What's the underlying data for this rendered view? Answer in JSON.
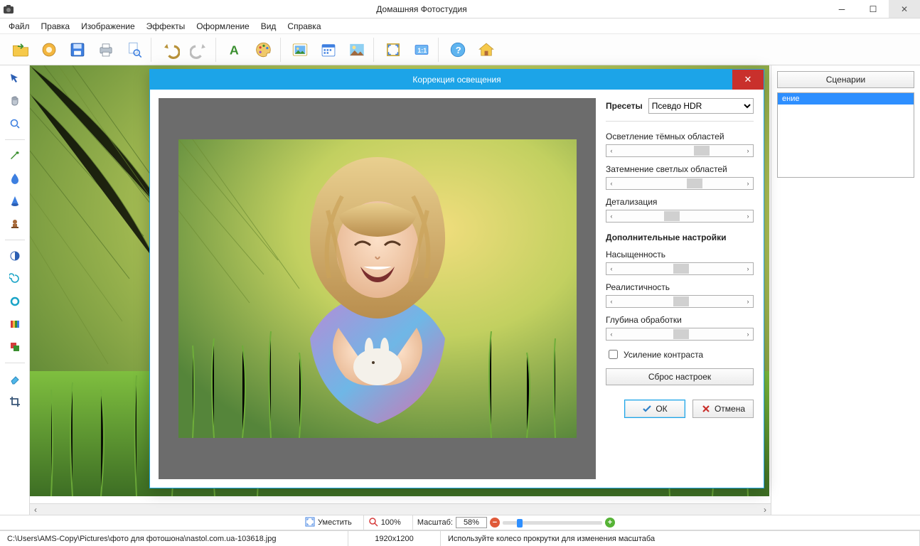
{
  "app": {
    "title": "Домашняя Фотостудия"
  },
  "menu": {
    "items": [
      "Файл",
      "Правка",
      "Изображение",
      "Эффекты",
      "Оформление",
      "Вид",
      "Справка"
    ]
  },
  "right_panel": {
    "scenarios_btn": "Сценарии",
    "active_item": "ение"
  },
  "dialog": {
    "title": "Коррекция освещения",
    "presets_label": "Пресеты",
    "preset_selected": "Псевдо HDR",
    "sliders": {
      "lighten": {
        "label": "Осветление тёмных областей",
        "pos": 68
      },
      "darken": {
        "label": "Затемнение светлых областей",
        "pos": 62
      },
      "detail": {
        "label": "Детализация",
        "pos": 42
      }
    },
    "extra_heading": "Дополнительные настройки",
    "extra_sliders": {
      "saturation": {
        "label": "Насыщенность",
        "pos": 50
      },
      "realism": {
        "label": "Реалистичность",
        "pos": 50
      },
      "depth": {
        "label": "Глубина обработки",
        "pos": 50
      }
    },
    "contrast_check": "Усиление контраста",
    "reset_btn": "Сброс настроек",
    "ok_btn": "ОК",
    "cancel_btn": "Отмена"
  },
  "zoom": {
    "fit_label": "Уместить",
    "hundred_label": "100%",
    "scale_label": "Масштаб:",
    "scale_value": "58%"
  },
  "status": {
    "path": "C:\\Users\\AMS-Copy\\Pictures\\фото для фотошона\\nastol.com.ua-103618.jpg",
    "dimensions": "1920x1200",
    "hint": "Используйте колесо прокрутки для изменения масштаба"
  }
}
